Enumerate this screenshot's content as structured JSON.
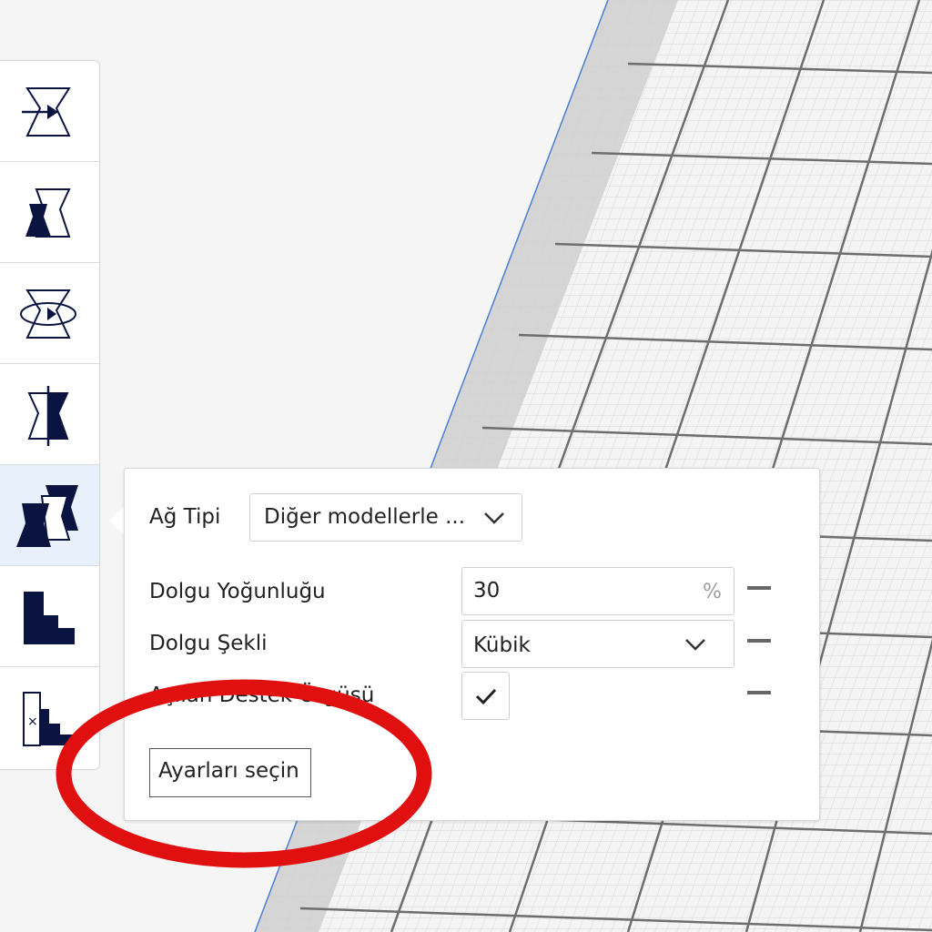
{
  "toolbar": {
    "tools": [
      {
        "icon": "move-icon"
      },
      {
        "icon": "scale-icon"
      },
      {
        "icon": "rotate-icon"
      },
      {
        "icon": "mirror-icon"
      },
      {
        "icon": "per-model-settings-icon",
        "active": true
      },
      {
        "icon": "support-blocker-icon"
      },
      {
        "icon": "remove-support-icon"
      }
    ]
  },
  "popup": {
    "mesh_type_label": "Ağ Tipi",
    "mesh_type_value": "Diğer modellerle ...",
    "infill_density_label": "Dolgu Yoğunluğu",
    "infill_density_value": "30",
    "infill_density_unit": "%",
    "infill_pattern_label": "Dolgu Şekli",
    "infill_pattern_value": "Kübik",
    "support_label": "Açılan Destek Örgüsü",
    "support_checked": true,
    "select_settings_button": "Ayarları seçin"
  },
  "annotation": {
    "circle_color": "#e01010"
  }
}
